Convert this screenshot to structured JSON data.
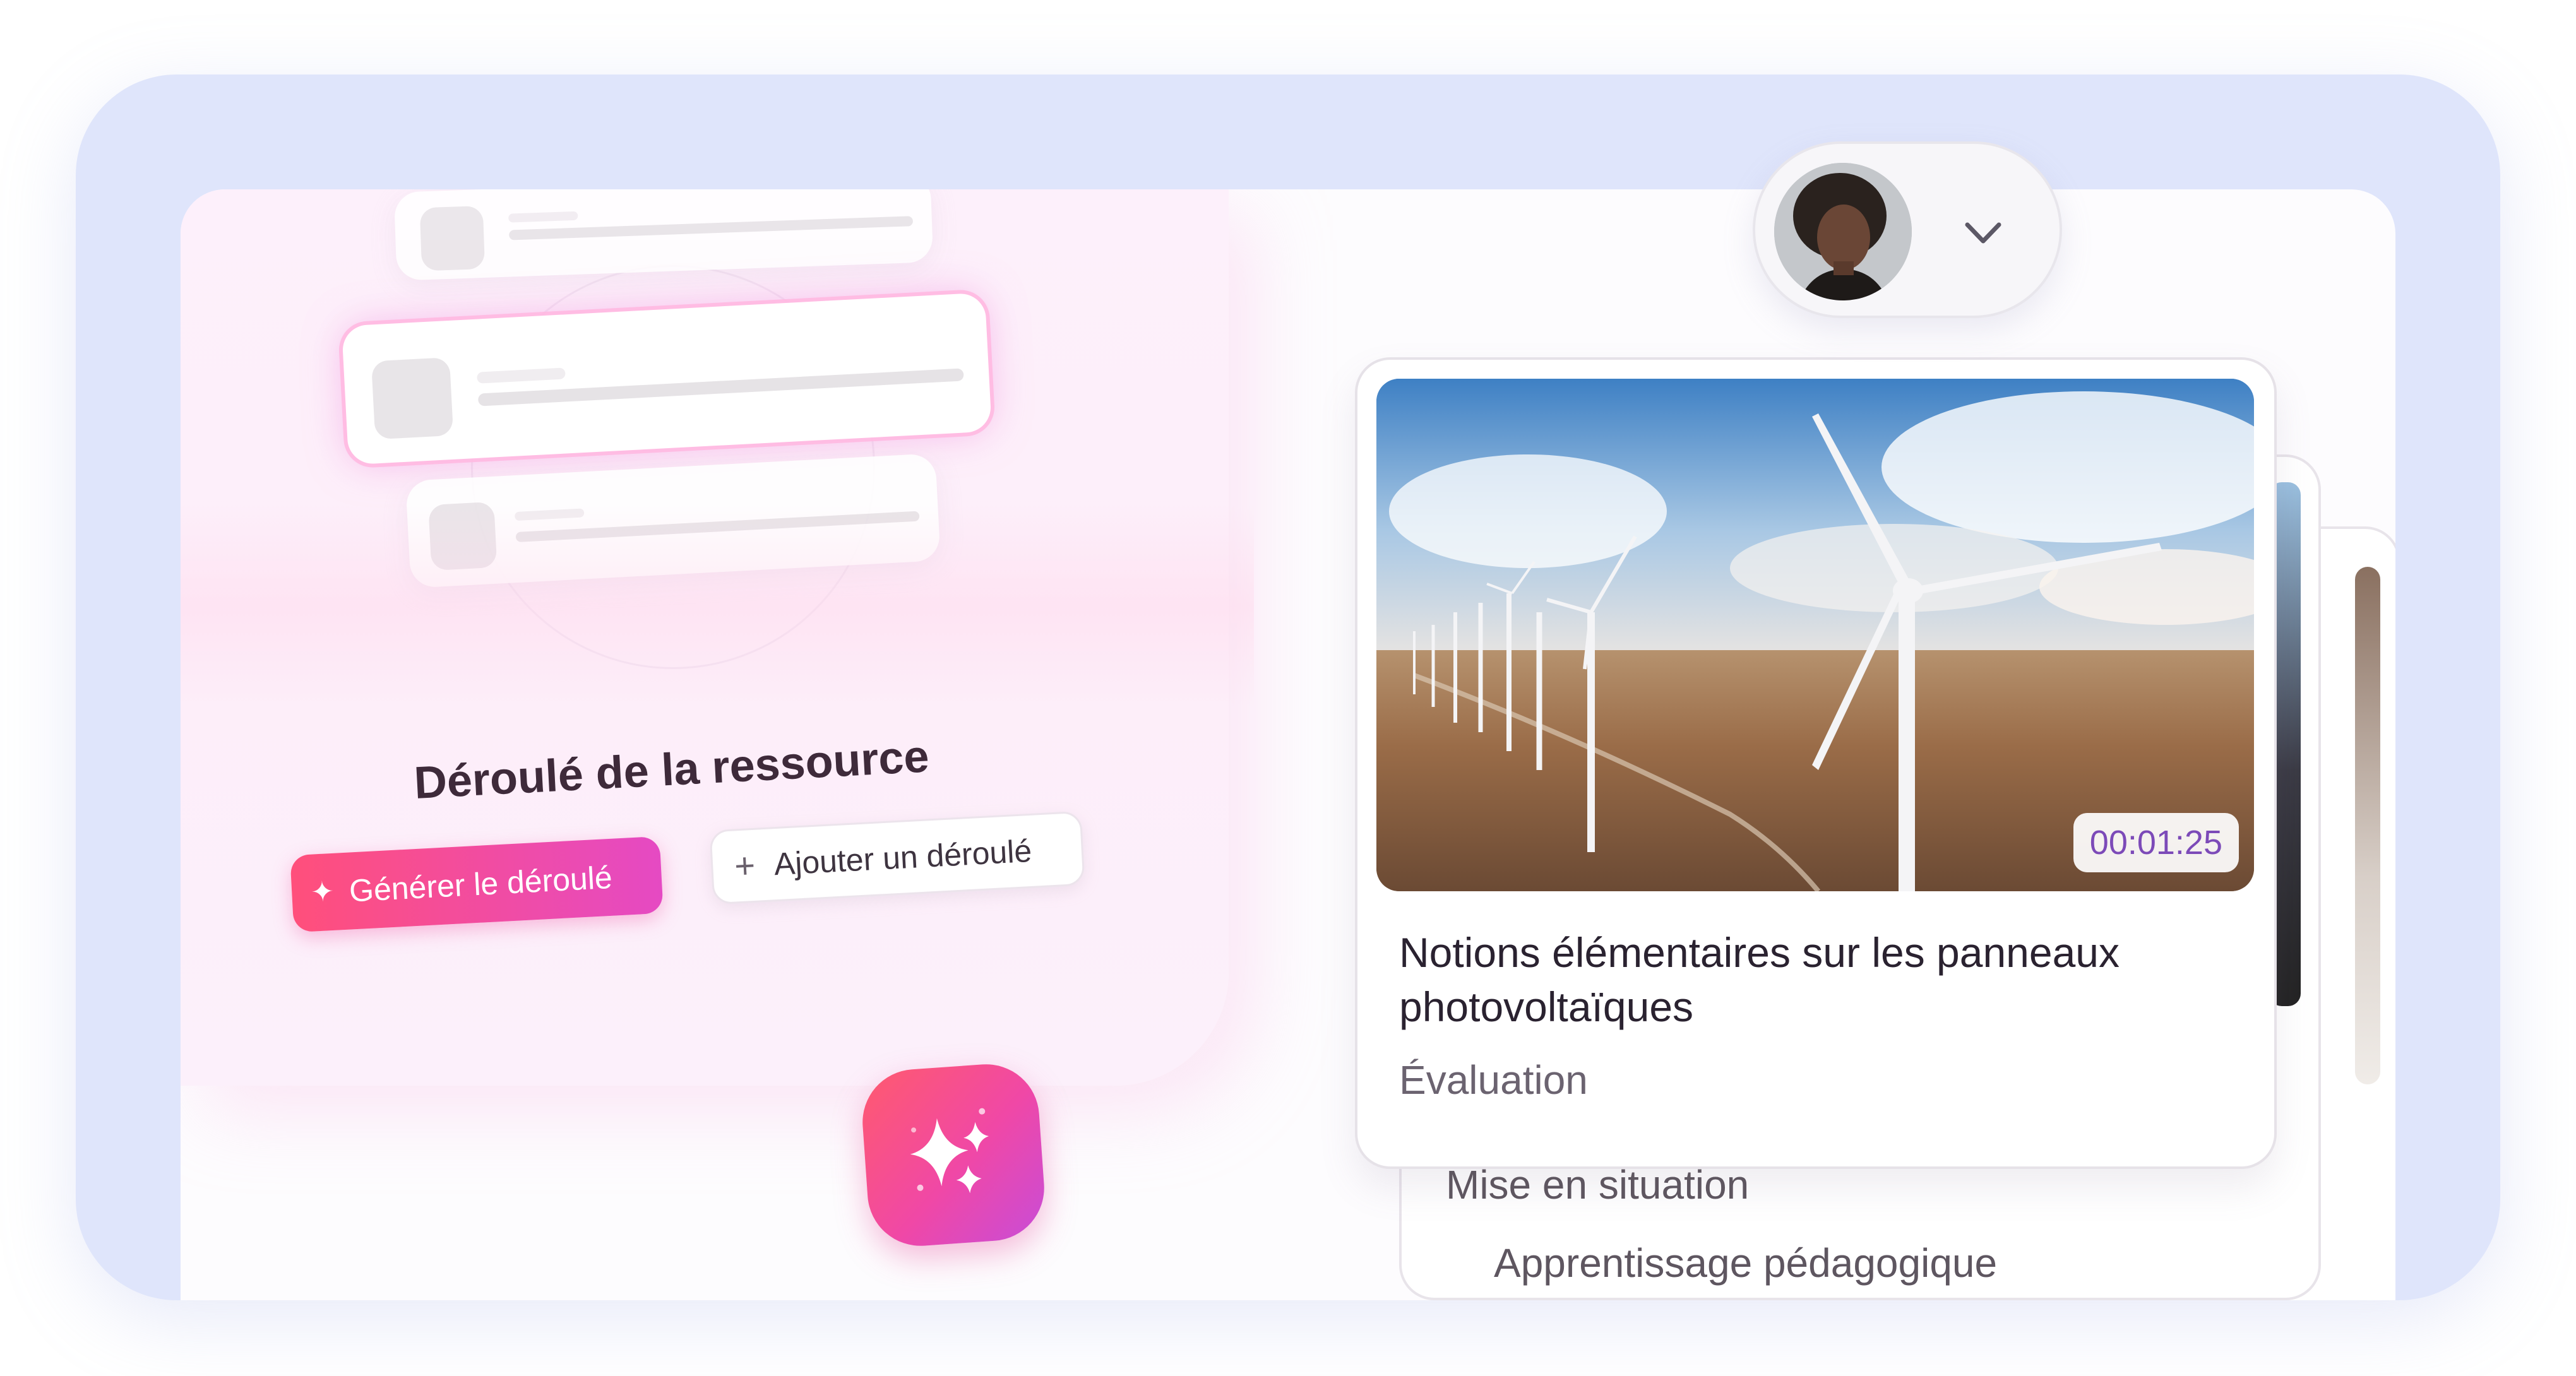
{
  "left_panel": {
    "title": "Déroulé de la ressource",
    "generate_button": {
      "label": "Générer le déroulé",
      "icon": "sparkles-icon"
    },
    "add_button": {
      "label": "Ajouter un déroulé",
      "icon": "plus-icon"
    }
  },
  "ai_assistant": {
    "icon": "sparkles-icon"
  },
  "profile": {
    "avatar": "user-avatar",
    "dropdown_icon": "chevron-down-icon"
  },
  "cards": {
    "main": {
      "duration": "00:01:25",
      "title": "Notions élémentaires sur les panneaux photovoltaïques",
      "category": "Évaluation"
    },
    "back_1": {
      "category": "Mise en situation"
    },
    "back_2": {
      "category": "Apprentissage pédagogique"
    }
  },
  "colors": {
    "frame": "#dfe5fb",
    "accent_gradient_start": "#ff4f7b",
    "accent_gradient_end": "#e54ac3",
    "badge_text": "#7c4ab8"
  }
}
